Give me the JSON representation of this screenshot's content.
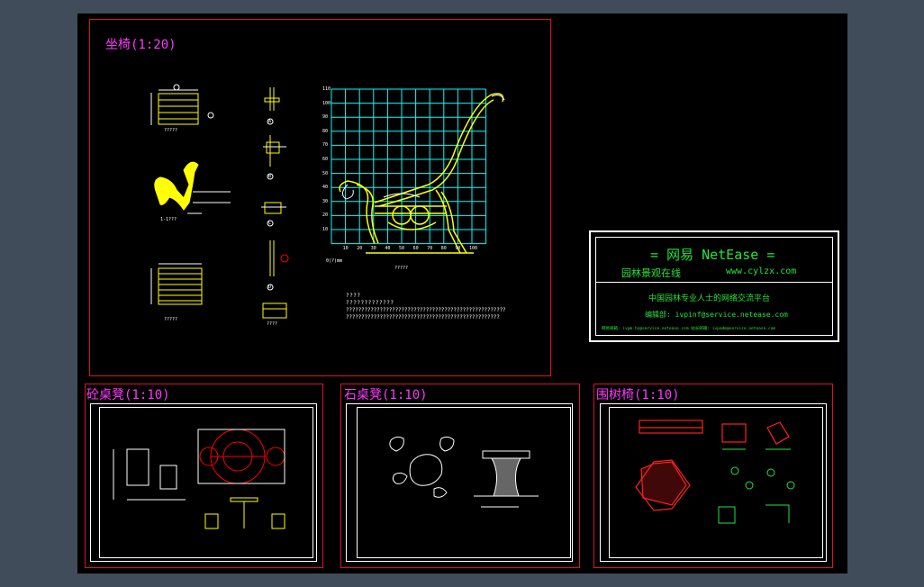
{
  "drawing": {
    "sheet_title": "坐椅(1:20)",
    "panels": [
      {
        "title": "砼桌凳(1:10)"
      },
      {
        "title": "石桌凳(1:10)"
      },
      {
        "title": "围树椅(1:10)"
      }
    ],
    "seat_labels": {
      "front": "?????",
      "side": "1-1???",
      "plan": "?????",
      "chart": "?????",
      "detail_a": "A",
      "detail_b": "B",
      "detail_c": "C",
      "detail_d": "D",
      "section": "????"
    },
    "notes": [
      "????",
      "?????????????",
      "????????????????????????????????????????????????????",
      "??????????????????????????????????????????????????"
    ],
    "axis_y_ticks": [
      "10",
      "20",
      "30",
      "40",
      "50",
      "60",
      "70",
      "80",
      "90",
      "100",
      "110"
    ],
    "axis_x_ticks": [
      "10",
      "20",
      "30",
      "40",
      "50",
      "60",
      "70",
      "80",
      "90",
      "100"
    ],
    "axis_origin": "0(?)mm",
    "colors": {
      "frame": "#e0102a",
      "title": "#ff38ff",
      "line": "#ffff00",
      "grid": "#00ffff",
      "logo": "#24e43c",
      "accent": "#ff0000"
    }
  },
  "logo": {
    "line1": "= 网易 NetEase =",
    "line2_left": "园林景观在线",
    "line2_right": "www.cylzx.com",
    "line3": "中国园林专业人士的网络交流平台",
    "line4": "编辑部: ivpinf@service.netease.com",
    "line5": "网易邮箱: ivpm.hz@service.netease.com  站长邮箱: ivpadm@service.netease.com"
  }
}
